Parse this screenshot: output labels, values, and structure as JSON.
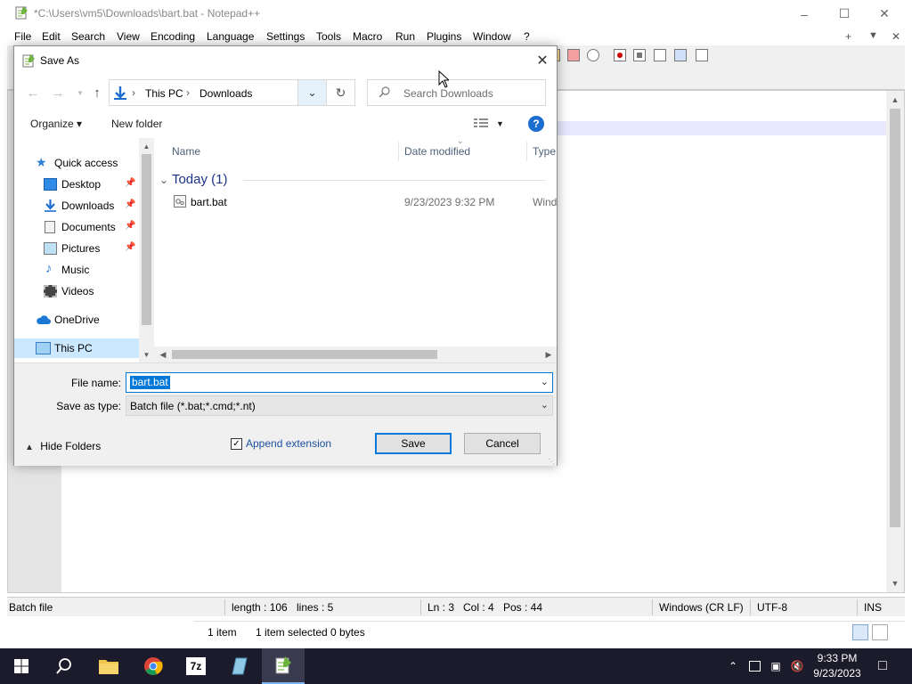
{
  "npp": {
    "title": "*C:\\Users\\vm5\\Downloads\\bart.bat - Notepad++",
    "menu": [
      "File",
      "Edit",
      "Search",
      "View",
      "Encoding",
      "Language",
      "Settings",
      "Tools",
      "Macro",
      "Run",
      "Plugins",
      "Window",
      "?"
    ],
    "menu_right": [
      "+",
      "▼",
      "✕"
    ],
    "status": {
      "type": "Batch file",
      "length": "length : 106",
      "lines": "lines : 5",
      "ln": "Ln : 3",
      "col": "Col : 4",
      "pos": "Pos : 44",
      "eol": "Windows (CR LF)",
      "encoding": "UTF-8",
      "mode": "INS"
    }
  },
  "explorer_bg": {
    "items": "1 item",
    "selected": "1 item selected  0 bytes"
  },
  "dialog": {
    "title": "Save As",
    "breadcrumb": [
      "This PC",
      "Downloads"
    ],
    "search_placeholder": "Search Downloads",
    "organize": "Organize ▾",
    "new_folder": "New folder",
    "nav": [
      {
        "label": "Quick access",
        "icon": "star-icon",
        "pinned": false
      },
      {
        "label": "Desktop",
        "icon": "desktop-icon",
        "pinned": true
      },
      {
        "label": "Downloads",
        "icon": "download-icon",
        "pinned": true
      },
      {
        "label": "Documents",
        "icon": "documents-icon",
        "pinned": true
      },
      {
        "label": "Pictures",
        "icon": "pictures-icon",
        "pinned": true
      },
      {
        "label": "Music",
        "icon": "music-icon",
        "pinned": false
      },
      {
        "label": "Videos",
        "icon": "videos-icon",
        "pinned": false
      },
      {
        "label": "OneDrive",
        "icon": "cloud-icon",
        "pinned": false
      },
      {
        "label": "This PC",
        "icon": "computer-icon",
        "pinned": false
      }
    ],
    "columns": {
      "name": "Name",
      "date": "Date modified",
      "type": "Type"
    },
    "group": "Today (1)",
    "file": {
      "name": "bart.bat",
      "date": "9/23/2023 9:32 PM",
      "type": "Wind"
    },
    "file_name_label": "File name:",
    "file_name_value": "bart.bat",
    "save_type_label": "Save as type:",
    "save_type_value": "Batch file (*.bat;*.cmd;*.nt)",
    "hide_folders": "Hide Folders",
    "append_extension": "Append extension",
    "save": "Save",
    "cancel": "Cancel"
  },
  "taskbar": {
    "time": "9:33 PM",
    "date": "9/23/2023"
  },
  "colors": {
    "accent": "#0078d7",
    "selection": "#cce8ff",
    "taskbar": "#1b1b2b"
  }
}
